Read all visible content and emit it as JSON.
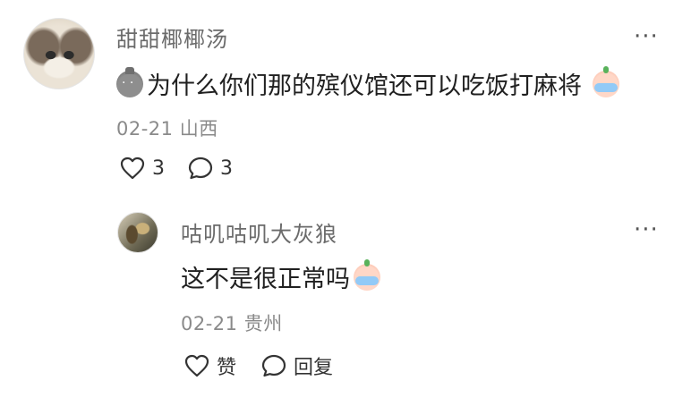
{
  "comment": {
    "username": "甜甜椰椰汤",
    "content": "为什么你们那的殡仪馆还可以吃饭打麻将",
    "date": "02-21",
    "location": "山西",
    "likes": "3",
    "replies": "3",
    "more": "···",
    "icons": {
      "content_prefix": "bag-sticker-icon",
      "content_suffix": "crying-sticker-icon"
    }
  },
  "reply": {
    "username": "咕叽咕叽大灰狼",
    "content": "这不是很正常吗",
    "date": "02-21",
    "location": "贵州",
    "like_label": "赞",
    "reply_label": "回复",
    "more": "···",
    "icons": {
      "content_suffix": "crying-sticker-icon"
    }
  }
}
